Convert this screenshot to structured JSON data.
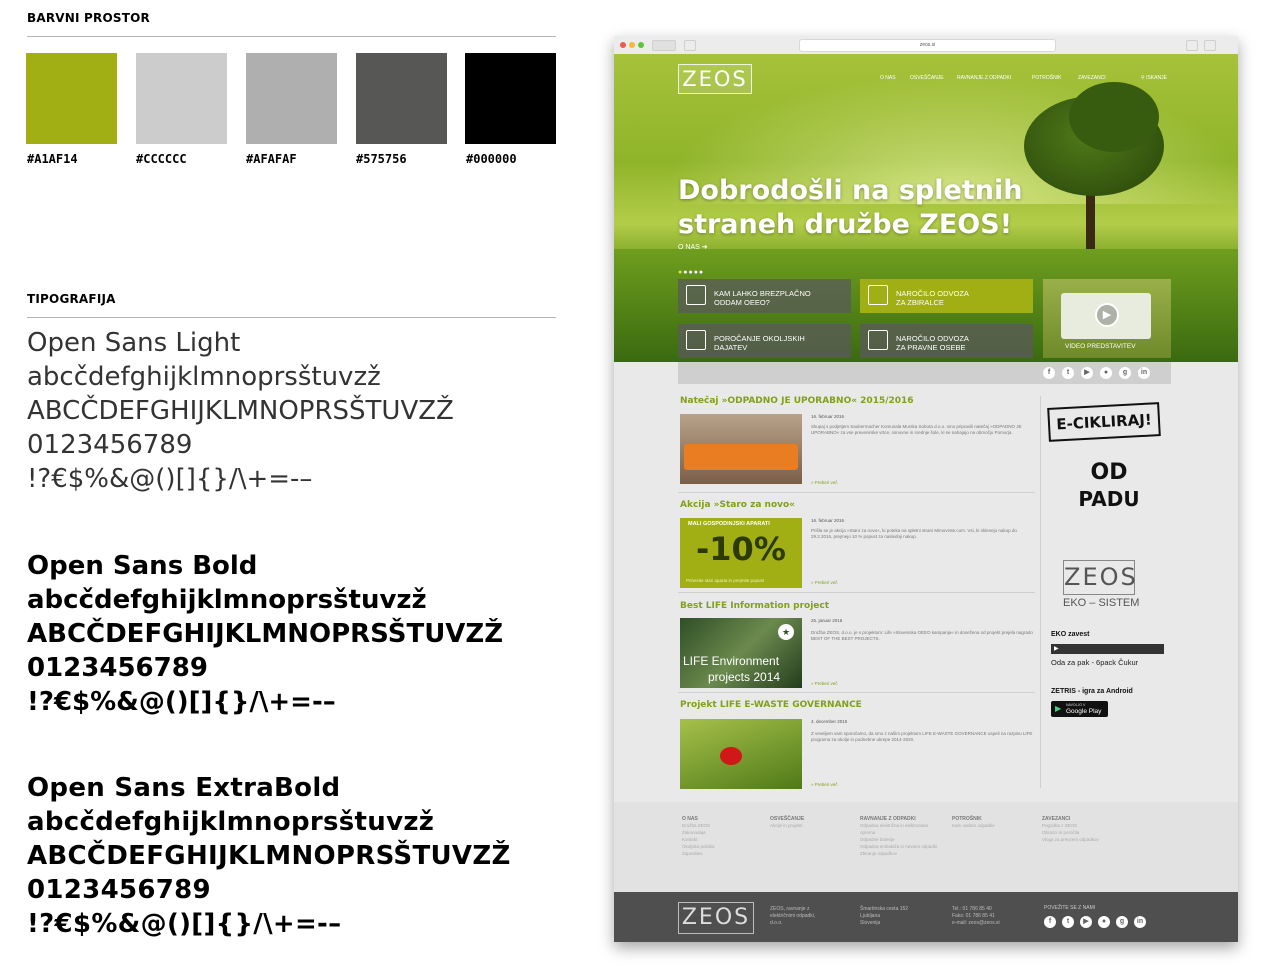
{
  "color_section": {
    "title": "BARVNI PROSTOR",
    "swatches": [
      {
        "hex": "#A1AF14",
        "label": "#A1AF14"
      },
      {
        "hex": "#CCCCCC",
        "label": "#CCCCCC"
      },
      {
        "hex": "#AFAFAF",
        "label": "#AFAFAF"
      },
      {
        "hex": "#575756",
        "label": "#575756"
      },
      {
        "hex": "#000000",
        "label": "#000000"
      }
    ]
  },
  "typography": {
    "title": "TIPOGRAFIJA",
    "blocks": [
      {
        "name": "Open Sans Light",
        "lower": "abcčdefghijklmnoprsštuvzž",
        "upper": "ABCČDEFGHIJKLMNOPRSŠTUVZŽ",
        "digits": "0123456789",
        "symbols": "!?€$%&@()[]{}/\\+=-–"
      },
      {
        "name": "Open Sans Bold",
        "lower": "abcčdefghijklmnoprsštuvzž",
        "upper": "ABCČDEFGHIJKLMNOPRSŠTUVZŽ",
        "digits": "0123456789",
        "symbols": "!?€$%&@()[]{}/\\+=-–"
      },
      {
        "name": "Open Sans ExtraBold",
        "lower": "abcčdefghijklmnoprsštuvzž",
        "upper": "ABCČDEFGHIJKLMNOPRSŠTUVZŽ",
        "digits": "0123456789",
        "symbols": "!?€$%&@()[]{}/\\+=-–"
      }
    ]
  },
  "website": {
    "url": "zeos.si",
    "logo": "ZEOS",
    "nav": [
      "O NAS",
      "OSVEŠČANJE",
      "RAVNANJE Z ODPADKI",
      "POTROŠNIK",
      "ZAVEZANCI",
      "ISKANJE"
    ],
    "hero_title_1": "Dobrodošli na spletnih",
    "hero_title_2": "straneh družbe  ZEOS!",
    "hero_link": "O NAS",
    "tiles": [
      {
        "line1": "KAM LAHKO BREZPLAČNO",
        "line2": "ODDAM OEEO?"
      },
      {
        "line1": "NAROČILO ODVOZA",
        "line2": "ZA ZBIRALCE"
      },
      {
        "line1": "POROČANJE OKOLJSKIH",
        "line2": "DAJATEV"
      },
      {
        "line1": "NAROČILO ODVOZA",
        "line2": "ZA PRAVNE OSEBE"
      }
    ],
    "video_label": "VIDEO PREDSTAVITEV",
    "posts": [
      {
        "title": "Natečaj »ODPADNO JE UPORABNO« 2015/2016",
        "date": "16. februar 2016",
        "text": "Skupaj s podjetjem Saubermacher Komunala Murska Sobota d.o.o. smo pripravili natečaj »ODPADNO JE UPORABNO« za vse prevenirske vrtce, osnovne in srednje šole, ki se nahajajo na območju Pomurja.",
        "more": "» Preberi več"
      },
      {
        "title": "Akcija »Staro za novo«",
        "date": "16. februar 2016",
        "text": "Prišla se je akcija »Staro za novo«, ki poteka na spletni strani Mimovrste.com. Vsi, ki sklenejo nakup do 29.2.2016, prejmejo 10 % popust za naslednji nakup.",
        "more": "» Preberi več",
        "promo_head": "MALI GOSPODINJSKI APARATI",
        "promo_value": "-10%",
        "promo_foot": "Prinesite stari aparat in prejmite popust"
      },
      {
        "title": "Best LIFE Information project",
        "date": "25. januar 2016",
        "text": "Družba ZEOS, d.o.o. je s projektom: Life »Slovenska OEEO kampanja« in dosežena od projekt prejela nagrado BEST OF THE BEST PROJECTS.",
        "more": "» Preberi več",
        "image_caption_1": "LIFE Environment",
        "image_caption_2": "projects 2014"
      },
      {
        "title": "Projekt LIFE E-WASTE GOVERNANCE",
        "date": "4. december 2015",
        "text": "Z veseljem vam sporočamo, da smo z našim projektom LIFE E-WASTE GOVERNANCE uspeli na razpisu LIFE programa za okolje in podnebne ukrepe 2014-2020.",
        "more": "» Preberi več"
      }
    ],
    "sidebar": {
      "ecikliraj": "E-CIKLIRAJ!",
      "odpadu_1": "OD",
      "odpadu_2": "PADU",
      "zeos_logo": "ZEOS",
      "eko_sistem": "EKO – SISTEM",
      "eko_zavest": "EKO zavest",
      "video_caption": "Oda za pak - 6pack Čukur",
      "zetris": "ZETRIS - igra za Android",
      "gplay_small": "NAVOLJO V",
      "gplay": "Google Play"
    },
    "footer_cols": [
      {
        "head": "O NAS",
        "items": [
          "Družba ZEOS",
          "Zakonodaja",
          "Kontakt",
          "Okoljska politika",
          "Zaposlitev"
        ]
      },
      {
        "head": "OSVEŠČANJE",
        "items": [
          "Akcije in projekti"
        ]
      },
      {
        "head": "RAVNANJE Z ODPADKI",
        "items": [
          "Odpadna električna in elektronska oprema",
          "Odpadne baterije",
          "Odpadna embalaža in nevarni odpadki",
          "Zbiranje odpadkov"
        ]
      },
      {
        "head": "POTROŠNIK",
        "items": [
          "Kam oddam odpadke"
        ]
      },
      {
        "head": "ZAVEZANCI",
        "items": [
          "Pogodba z ZEOS",
          "Obrazci in poročila",
          "Vloga za prevzem odpadkov"
        ]
      }
    ],
    "footer": {
      "logo": "ZEOS",
      "addr_1": "ZEOS, ravnanje z",
      "addr_2": "električnimi odpadki,",
      "addr_3": "d.o.o.",
      "street_1": "Šmartinska cesta 152",
      "street_2": "Ljubljana",
      "street_3": "Slovenija",
      "contact_1": "Tel.: 01 786 85 40",
      "contact_2": "Faks: 01 786 85 41",
      "contact_3": "e-mail: zeos@zeos.si",
      "connect": "POVEŽITE SE Z NAMI"
    },
    "social_icons": [
      "f",
      "t",
      "▶",
      "●",
      "g",
      "in"
    ]
  }
}
